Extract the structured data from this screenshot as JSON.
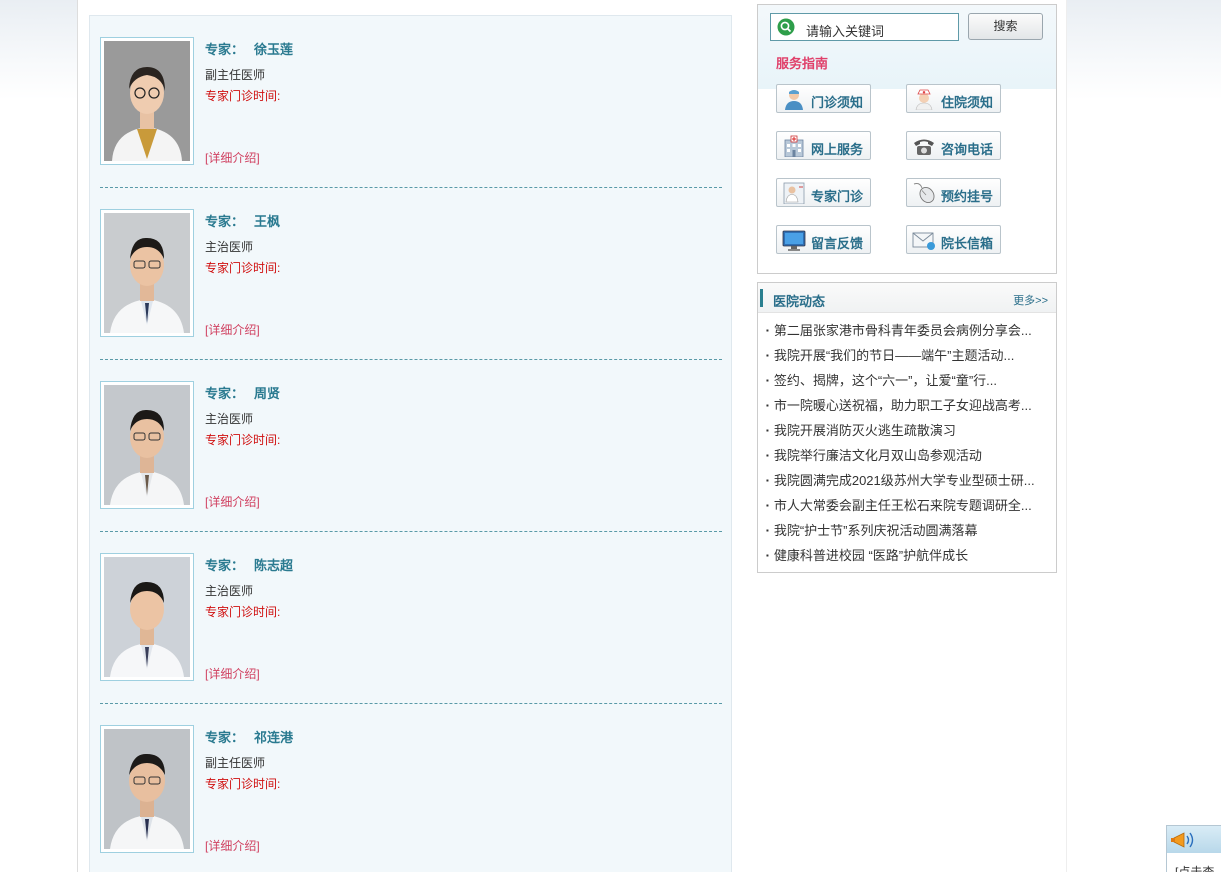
{
  "doctors": [
    {
      "label": "专家：",
      "name": "徐玉莲",
      "title": "副主任医师",
      "time_label": "专家门诊时间:",
      "more": "[详细介绍]",
      "gender": "f"
    },
    {
      "label": "专家：",
      "name": "王枫",
      "title": "主治医师",
      "time_label": "专家门诊时间:",
      "more": "[详细介绍]",
      "gender": "m"
    },
    {
      "label": "专家：",
      "name": "周贤",
      "title": "主治医师",
      "time_label": "专家门诊时间:",
      "more": "[详细介绍]",
      "gender": "m"
    },
    {
      "label": "专家：",
      "name": "陈志超",
      "title": "主治医师",
      "time_label": "专家门诊时间:",
      "more": "[详细介绍]",
      "gender": "m"
    },
    {
      "label": "专家：",
      "name": "祁连港",
      "title": "副主任医师",
      "time_label": "专家门诊时间:",
      "more": "[详细介绍]",
      "gender": "m"
    }
  ],
  "search": {
    "placeholder": "请输入关键词",
    "button": "搜索"
  },
  "guide": {
    "title": "服务指南",
    "items": [
      {
        "label": "门诊须知",
        "icon": "nurse-icon"
      },
      {
        "label": "住院须知",
        "icon": "nurse-cap-icon"
      },
      {
        "label": "网上服务",
        "icon": "hospital-building-icon"
      },
      {
        "label": "咨询电话",
        "icon": "telephone-icon"
      },
      {
        "label": "专家门诊",
        "icon": "doctor-card-icon"
      },
      {
        "label": "预约挂号",
        "icon": "mouse-icon"
      },
      {
        "label": "留言反馈",
        "icon": "monitor-icon"
      },
      {
        "label": "院长信箱",
        "icon": "envelope-icon"
      }
    ]
  },
  "news": {
    "title": "医院动态",
    "more": "更多>>",
    "items": [
      "第二届张家港市骨科青年委员会病例分享会...",
      "我院开展“我们的节日——端午”主题活动...",
      "签约、揭牌，这个“六一”，让爱“童”行...",
      "市一院暖心送祝福，助力职工子女迎战高考...",
      "我院开展消防灭火逃生疏散演习",
      "我院举行廉洁文化月双山岛参观活动",
      "我院圆满完成2021级苏州大学专业型硕士研...",
      "市人大常委会副主任王松石来院专题调研全...",
      "我院“护士节”系列庆祝活动圆满落幕",
      "健康科普进校园 “医路”护航伴成长"
    ]
  },
  "float_widget": {
    "text": "[点击查",
    "icon": "megaphone-icon"
  }
}
